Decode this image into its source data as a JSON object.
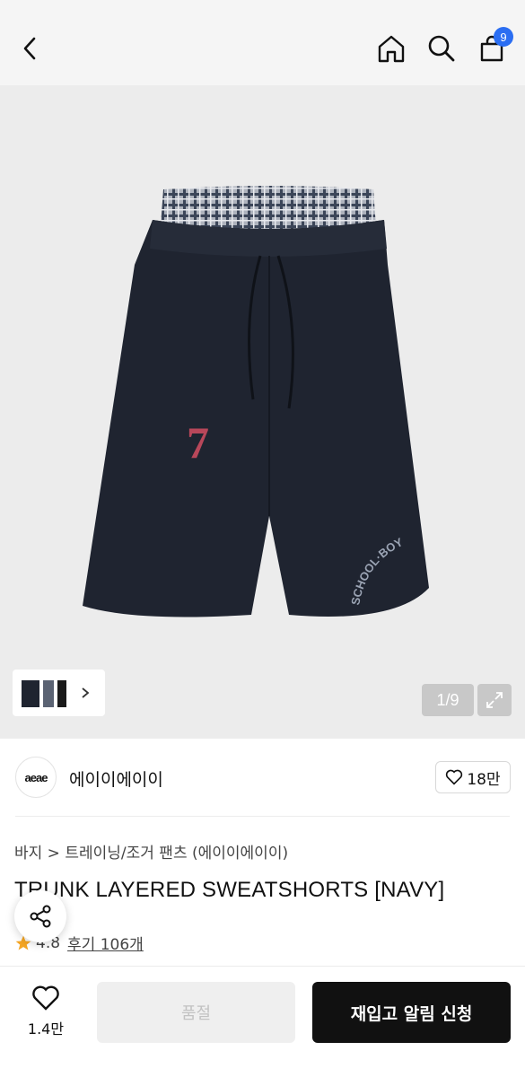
{
  "header": {
    "cart_count": "9"
  },
  "gallery": {
    "counter": "1/9"
  },
  "brand": {
    "logo_text": "aeae",
    "name": "에이이에이이",
    "likes": "18만"
  },
  "product": {
    "breadcrumb": "바지 > 트레이닝/조거 팬츠 (에이이에이이)",
    "title": "TRUNK LAYERED SWEATSHORTS [NAVY]",
    "rating": "4.8",
    "reviews": "후기 106개"
  },
  "bottom_bar": {
    "wish_count": "1.4만",
    "soldout_label": "품절",
    "restock_label": "재입고 알림 신청"
  },
  "colors": {
    "accent_badge": "#2b6ef2",
    "star": "#f5a623",
    "primary_button": "#111111",
    "shorts_navy": "#1f2430"
  }
}
